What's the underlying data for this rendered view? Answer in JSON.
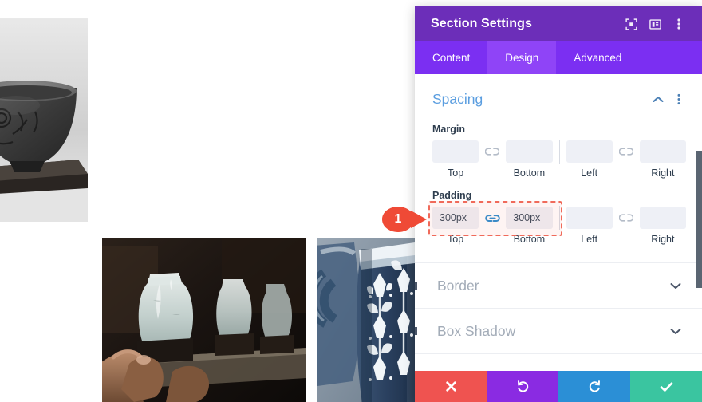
{
  "canvas": {
    "photos": [
      {
        "name": "grayscale-bowl-on-wooden-board",
        "alt": "Dark ceramic bowl with floral relief on a wooden board, black and white"
      },
      {
        "name": "hands-holding-celadon-pots",
        "alt": "Potter's hands holding pale celadon glazed jars on a workbench"
      },
      {
        "name": "blue-white-patterned-jug",
        "alt": "Blue and white folk-patterned ceramic jug close-up"
      }
    ]
  },
  "annotation": {
    "badge_number": "1",
    "badge_color": "#ef4a36"
  },
  "panel": {
    "title": "Section Settings",
    "header_icons": [
      {
        "name": "focus-target-icon",
        "label": "focus"
      },
      {
        "name": "panel-layout-icon",
        "label": "layout"
      },
      {
        "name": "more-options-icon",
        "label": "more"
      }
    ],
    "tabs": [
      {
        "label": "Content",
        "active": false
      },
      {
        "label": "Design",
        "active": true
      },
      {
        "label": "Advanced",
        "active": false
      }
    ],
    "spacing": {
      "title": "Spacing",
      "collapse_icon": "chevron-up-icon",
      "options_icon": "more-options-icon",
      "margin": {
        "label": "Margin",
        "link_state_vertical": "unlinked",
        "link_state_horizontal": "unlinked",
        "fields": [
          {
            "label": "Top",
            "value": "",
            "placeholder": ""
          },
          {
            "label": "Bottom",
            "value": "",
            "placeholder": ""
          },
          {
            "label": "Left",
            "value": "",
            "placeholder": ""
          },
          {
            "label": "Right",
            "value": "",
            "placeholder": ""
          }
        ]
      },
      "padding": {
        "label": "Padding",
        "link_state_vertical": "linked",
        "link_state_horizontal": "unlinked",
        "highlighted": true,
        "fields": [
          {
            "label": "Top",
            "value": "300px",
            "placeholder": ""
          },
          {
            "label": "Bottom",
            "value": "300px",
            "placeholder": ""
          },
          {
            "label": "Left",
            "value": "",
            "placeholder": ""
          },
          {
            "label": "Right",
            "value": "",
            "placeholder": ""
          }
        ]
      }
    },
    "sections": [
      {
        "label": "Border",
        "expand_icon": "chevron-down-icon"
      },
      {
        "label": "Box Shadow",
        "expand_icon": "chevron-down-icon"
      }
    ],
    "footer": [
      {
        "name": "cancel-button",
        "icon": "close-icon",
        "color": "#ef5350"
      },
      {
        "name": "undo-button",
        "icon": "undo-icon",
        "color": "#8a2be2"
      },
      {
        "name": "redo-button",
        "icon": "redo-icon",
        "color": "#2b8fd6"
      },
      {
        "name": "save-button",
        "icon": "check-icon",
        "color": "#3ac5a0"
      }
    ],
    "colors": {
      "header": "#6c2eb9",
      "tabbar": "#7b2ff2",
      "tab_active": "#8f44f7",
      "section_title": "#5b9ee0",
      "highlight": "#f06a5a"
    }
  }
}
